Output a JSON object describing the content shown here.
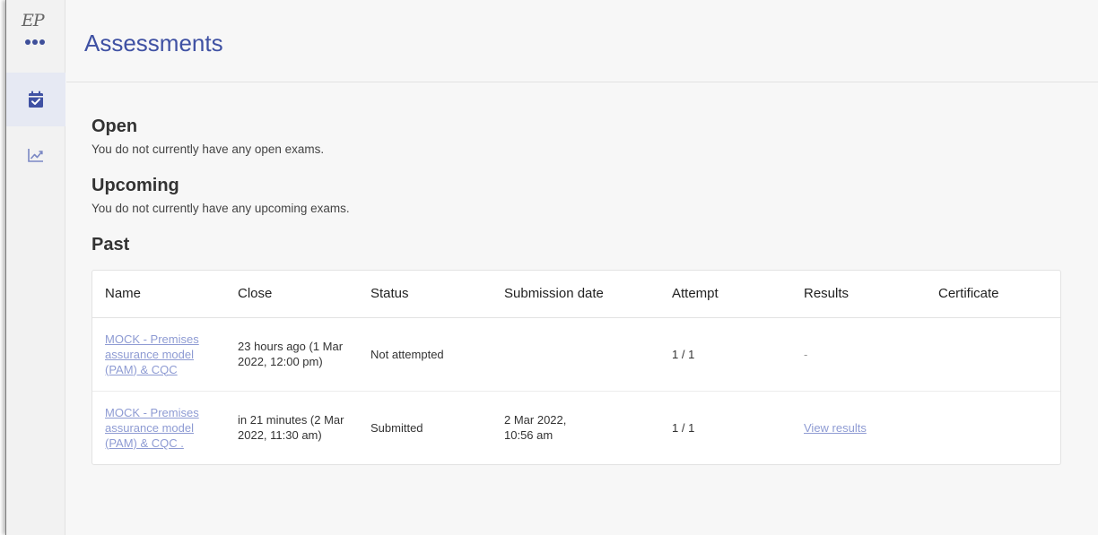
{
  "app": {
    "logo_text": "EP",
    "accent_color": "#3f51a3",
    "link_color": "#8e9bd3"
  },
  "rail": {
    "items": [
      {
        "icon": "calendar-check-icon",
        "active": true
      },
      {
        "icon": "trending-chart-icon",
        "active": false
      }
    ]
  },
  "header": {
    "title": "Assessments"
  },
  "sections": {
    "open": {
      "title": "Open",
      "text": "You do not currently have any open exams."
    },
    "upcoming": {
      "title": "Upcoming",
      "text": "You do not currently have any upcoming exams."
    },
    "past": {
      "title": "Past"
    }
  },
  "table": {
    "columns": [
      "Name",
      "Close",
      "Status",
      "Submission date",
      "Attempt",
      "Results",
      "Certificate"
    ],
    "rows": [
      {
        "name_lines": [
          "MOCK - Premises",
          "assurance model",
          "(PAM) & CQC"
        ],
        "close_lines": [
          "23 hours ago (1 Mar",
          "2022, 12:00 pm)"
        ],
        "status": "Not attempted",
        "submission_lines": [],
        "attempt": "1 / 1",
        "results": "-",
        "results_is_link": false,
        "certificate": ""
      },
      {
        "name_lines": [
          "MOCK - Premises",
          "assurance model",
          "(PAM) & CQC ."
        ],
        "close_lines": [
          "in 21 minutes (2 Mar",
          "2022, 11:30 am)"
        ],
        "status": "Submitted",
        "submission_lines": [
          "2 Mar 2022,",
          "10:56 am"
        ],
        "attempt": "1 / 1",
        "results": "View results",
        "results_is_link": true,
        "certificate": ""
      }
    ]
  }
}
